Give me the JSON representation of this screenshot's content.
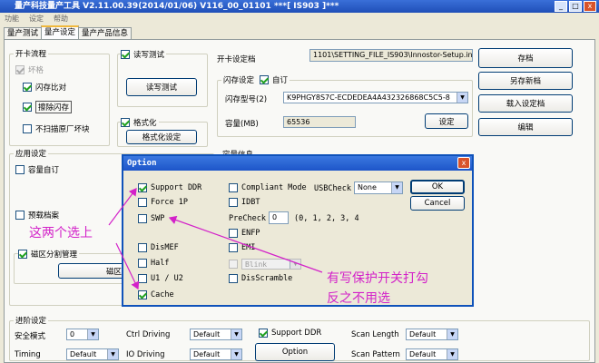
{
  "window": {
    "title": "量产科技量产工具  V2.11.00.39(2014/01/06)      V116_00_01101         ***[  IS903  ]***",
    "controls": [
      "_",
      "□",
      "x"
    ]
  },
  "menu": [
    "功能",
    "设定",
    "帮助"
  ],
  "tabs": [
    "量产测试",
    "量产设定",
    "量产产品信息"
  ],
  "card_flow": {
    "title": "开卡流程",
    "opt_flag": "坏格",
    "opt_flash_compare": "闪存比对",
    "opt_erase": "擦除闪存",
    "opt_no_scan": "不扫描原厂坏块"
  },
  "rw_test": {
    "label": "读写测试",
    "button": "读写测试"
  },
  "format": {
    "label": "格式化",
    "button": "格式化设定"
  },
  "setting_file": {
    "label": "开卡设定档",
    "value": "1101\\SETTING_FILE_IS903\\Innostor-Setup.ini"
  },
  "flash_settings": {
    "title": "闪存设定",
    "custom_label": "自订",
    "flash_model_label": "闪存型号(2)",
    "flash_model_value": "K9PHGY8S7C-ECDEDEA4A432326868C5C5-8",
    "capacity_label": "容量(MB)",
    "capacity_value": "65536",
    "settings_button": "设定",
    "capacity_info_label": "容量信息"
  },
  "side_buttons": {
    "save": "存档",
    "save_as": "另存新档",
    "load": "载入设定档",
    "edit": "编辑"
  },
  "app_settings": {
    "title": "应用设定",
    "custom_capacity": "容量自订",
    "preload": "预载档案",
    "partition_mgmt": "磁区分割管理",
    "partition_button": "磁区分割"
  },
  "advanced": {
    "title": "进阶设定",
    "safe_mode_label": "安全模式",
    "safe_mode_value": "0",
    "timing_label": "Timing",
    "timing_value": "Default",
    "ctrl_driving_label": "Ctrl Driving",
    "ctrl_driving_value": "Default",
    "io_driving_label": "IO Driving",
    "io_driving_value": "Default",
    "support_ddr_label": "Support DDR",
    "option_button": "Option",
    "scan_length_label": "Scan Length",
    "scan_length_value": "Default",
    "scan_pattern_label": "Scan Pattern",
    "scan_pattern_value": "Default"
  },
  "dialog": {
    "title": "Option",
    "close": "x",
    "support_ddr": "Support DDR",
    "force_1p": "Force 1P",
    "swp": "SWP",
    "dismef": "DisMEF",
    "half": "Half",
    "u1u2": "U1 / U2",
    "cache": "Cache",
    "compliant_mode": "Compliant Mode",
    "idbt": "IDBT",
    "precheck_label": "PreCheck",
    "precheck_value": "0",
    "precheck_options": "(0, 1, 2, 3, 4",
    "enfp": "ENFP",
    "emi": "EMI",
    "blink_value": "Blink",
    "discramble": "DisScramble",
    "usbcheck_label": "USBCheck",
    "usbcheck_value": "None",
    "ok": "OK",
    "cancel": "Cancel"
  },
  "annotations": {
    "left": "这两个选上",
    "right_line1": "有写保护开关打勾",
    "right_line2": "反之不用选"
  },
  "colors": {
    "annotation": "#d321c9",
    "titlebar": "#1f4fb8"
  }
}
